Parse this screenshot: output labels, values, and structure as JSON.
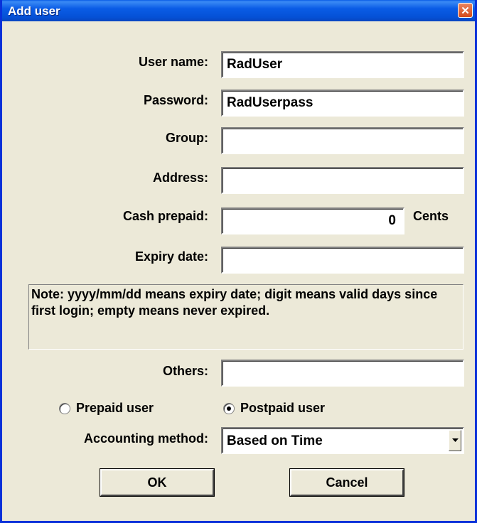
{
  "window": {
    "title": "Add user",
    "close_icon": "close-icon"
  },
  "fields": {
    "user_name": {
      "label": "User name:",
      "value": "RadUser"
    },
    "password": {
      "label": "Password:",
      "value": "RadUserpass"
    },
    "group": {
      "label": "Group:",
      "value": ""
    },
    "address": {
      "label": "Address:",
      "value": ""
    },
    "cash_prepaid": {
      "label": "Cash prepaid:",
      "value": "0",
      "unit": "Cents"
    },
    "expiry_date": {
      "label": "Expiry date:",
      "value": ""
    },
    "others": {
      "label": "Others:",
      "value": ""
    }
  },
  "note": "Note: yyyy/mm/dd means expiry date; digit means valid days since first login; empty means never expired.",
  "user_type": {
    "options": [
      {
        "label": "Prepaid user",
        "checked": false
      },
      {
        "label": "Postpaid user",
        "checked": true
      }
    ]
  },
  "accounting": {
    "label": "Accounting method:",
    "selected": "Based on Time",
    "arrow_icon": "chevron-down-icon"
  },
  "buttons": {
    "ok": "OK",
    "cancel": "Cancel"
  },
  "colors": {
    "titlebar": "#0a5ce6",
    "window_bg": "#ece9d8",
    "close_button": "#d54a1c"
  }
}
